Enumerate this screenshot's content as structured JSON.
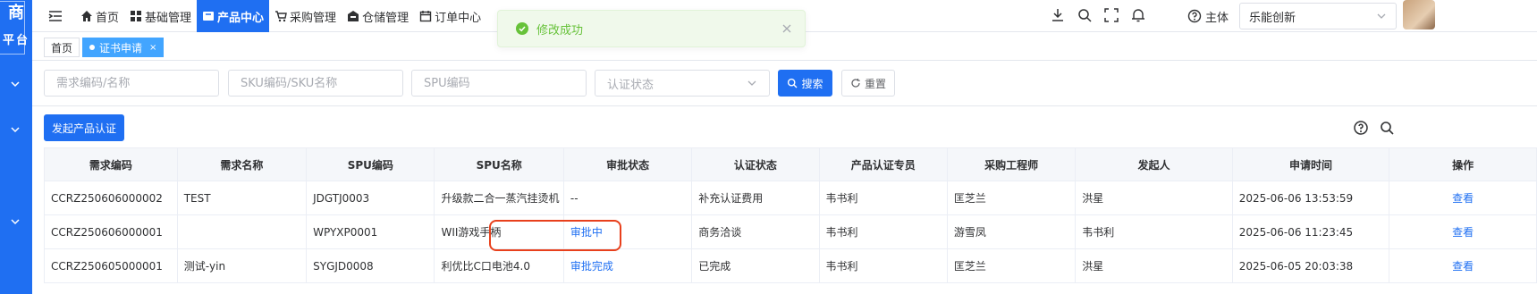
{
  "sidebar": {
    "brand_line1": "商",
    "brand_line2": "平台"
  },
  "nav": {
    "items": [
      {
        "label": "首页",
        "icon": "home-icon"
      },
      {
        "label": "基础管理",
        "icon": "grid-icon"
      },
      {
        "label": "产品中心",
        "icon": "product-icon",
        "active": true
      },
      {
        "label": "采购管理",
        "icon": "cart-icon"
      },
      {
        "label": "仓储管理",
        "icon": "warehouse-icon"
      },
      {
        "label": "订单中心",
        "icon": "calendar-icon"
      }
    ],
    "subject_label": "主体",
    "tenant_value": "乐能创新"
  },
  "tabs": [
    {
      "label": "首页",
      "active": false
    },
    {
      "label": "证书申请",
      "active": true,
      "close": "×"
    }
  ],
  "filters": {
    "demand_placeholder": "需求编码/名称",
    "sku_placeholder": "SKU编码/SKU名称",
    "spu_placeholder": "SPU编码",
    "status_placeholder": "认证状态",
    "search_label": "搜索",
    "reset_label": "重置"
  },
  "toolbar": {
    "launch_label": "发起产品认证"
  },
  "table": {
    "columns": [
      "需求编码",
      "需求名称",
      "SPU编码",
      "SPU名称",
      "审批状态",
      "认证状态",
      "产品认证专员",
      "采购工程师",
      "发起人",
      "申请时间",
      "操作"
    ],
    "rows": [
      {
        "code": "CCRZ250606000002",
        "name": "TEST",
        "spu_code": "JDGTJ0003",
        "spu_name": "升级款二合一蒸汽挂烫机",
        "approval": "--",
        "approval_link": false,
        "cert": "补充认证费用",
        "specialist": "韦书利",
        "engineer": "匡芝兰",
        "initiator": "洪星",
        "time": "2025-06-06 13:53:59",
        "action": "查看"
      },
      {
        "code": "CCRZ250606000001",
        "name": "",
        "spu_code": "WPYXP0001",
        "spu_name": "WII游戏手柄",
        "approval": "审批中",
        "approval_link": true,
        "cert": "商务洽谈",
        "specialist": "韦书利",
        "engineer": "游雪凤",
        "initiator": "韦书利",
        "time": "2025-06-06 11:23:45",
        "action": "查看"
      },
      {
        "code": "CCRZ250605000001",
        "name": "测试-yin",
        "spu_code": "SYGJD0008",
        "spu_name": "利优比C口电池4.0",
        "approval": "审批完成",
        "approval_link": true,
        "cert": "已完成",
        "specialist": "韦书利",
        "engineer": "匡芝兰",
        "initiator": "洪星",
        "time": "2025-06-05 20:03:38",
        "action": "查看"
      }
    ]
  },
  "toast": {
    "message": "修改成功"
  },
  "colors": {
    "primary": "#1f6ff2",
    "success": "#67c23a",
    "highlight": "#e8401c",
    "tab_active": "#42a5ff"
  }
}
